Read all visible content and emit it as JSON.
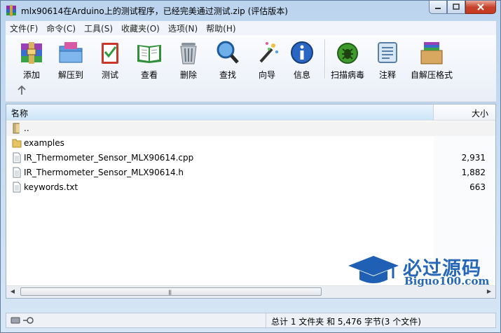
{
  "window": {
    "title": "mlx90614在Arduino上的测试程序，已经完美通过测试.zip (评估版本)"
  },
  "menu": [
    "文件(F)",
    "命令(C)",
    "工具(S)",
    "收藏夹(O)",
    "选项(N)",
    "帮助(H)"
  ],
  "toolbar": [
    {
      "label": "添加",
      "icon": "add-archive-icon"
    },
    {
      "label": "解压到",
      "icon": "extract-to-icon"
    },
    {
      "label": "测试",
      "icon": "test-icon"
    },
    {
      "label": "查看",
      "icon": "view-book-icon"
    },
    {
      "label": "删除",
      "icon": "delete-trash-icon"
    },
    {
      "label": "查找",
      "icon": "find-magnifier-icon"
    },
    {
      "label": "向导",
      "icon": "wizard-wand-icon"
    },
    {
      "label": "信息",
      "icon": "info-icon"
    },
    {
      "label": "扫描病毒",
      "icon": "virus-scan-icon"
    },
    {
      "label": "注释",
      "icon": "comment-icon"
    },
    {
      "label": "自解压格式",
      "icon": "sfx-box-icon"
    }
  ],
  "columns": {
    "name": "名称",
    "size": "大小"
  },
  "files": [
    {
      "name": "..",
      "size": "",
      "type": "parent"
    },
    {
      "name": "examples",
      "size": "",
      "type": "folder"
    },
    {
      "name": "IR_Thermometer_Sensor_MLX90614.cpp",
      "size": "2,931",
      "type": "file"
    },
    {
      "name": "IR_Thermometer_Sensor_MLX90614.h",
      "size": "1,882",
      "type": "file"
    },
    {
      "name": "keywords.txt",
      "size": "663",
      "type": "file"
    }
  ],
  "status": {
    "text": "总计 1 文件夹 和 5,476 字节(3 个文件)"
  },
  "watermark": {
    "title": "必过源码",
    "url": "Biguo100.com"
  }
}
